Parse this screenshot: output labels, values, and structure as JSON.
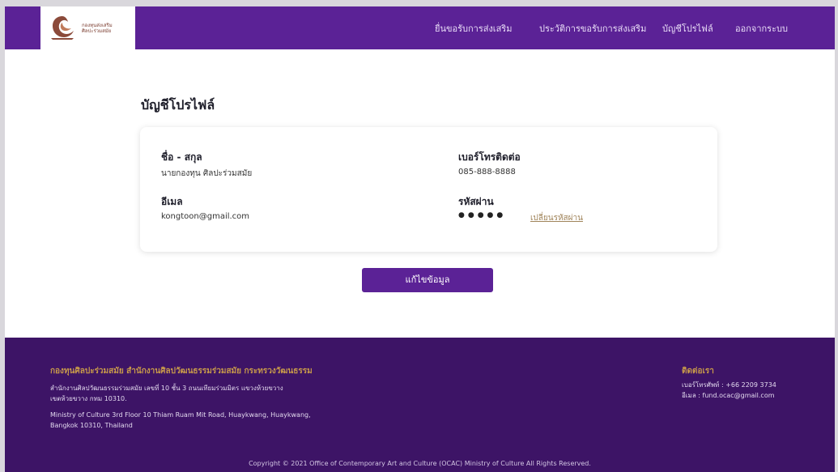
{
  "header": {
    "logo": {
      "line1": "กองทุนส่งเสริม",
      "line2": "ศิลปะร่วมสมัย"
    },
    "nav": [
      {
        "label": "ยื่นขอรับการส่งเสริม"
      },
      {
        "label": "ประวัติการขอรับการส่งเสริม"
      },
      {
        "label": "บัญชีโปรไฟล์"
      },
      {
        "label": "ออกจากระบบ"
      }
    ]
  },
  "main": {
    "title": "บัญชีโปรไฟล์",
    "profile": {
      "name_label": "ชื่อ - สกุล",
      "name_value": "นายกองทุน ศิลปะร่วมสมัย",
      "phone_label": "เบอร์โทรติดต่อ",
      "phone_value": "085-888-8888",
      "email_label": "อีเมล",
      "email_value": "kongtoon@gmail.com",
      "password_label": "รหัสผ่าน",
      "password_mask": "●●●●●",
      "change_password": "เปลี่ยนรหัสผ่าน"
    },
    "edit_button": "แก้ไขข้อมูล"
  },
  "footer": {
    "org_title": "กองทุนศิลปะร่วมสมัย สำนักงานศิลปวัฒนธรรมร่วมสมัย กระทรวงวัฒนธรรม",
    "address_th_1": "สำนักงานศิลปวัฒนธรรมร่วมสมัย เลขที่ 10 ชั้น 3 ถนนเทียมร่วมมิตร แขวงห้วยขวาง",
    "address_th_2": "เขตห้วยขวาง กทม 10310.",
    "address_en_1": "Ministry of Culture 3rd Floor 10 Thiam Ruam Mit Road, Huaykwang, Huaykwang,",
    "address_en_2": "Bangkok 10310, Thailand",
    "contact_title": "ติดต่อเรา",
    "contact_phone": "เบอร์โทรศัพท์ : +66 2209 3734",
    "contact_email": "อีเมล : fund.ocac@gmail.com",
    "copyright": "Copyright © 2021 Office of Contemporary Art and Culture (OCAC) Ministry of Culture All Rights Reserved."
  },
  "colors": {
    "primary": "#5b2296",
    "footer_bg": "#3d1466",
    "accent_gold": "#c89a4a"
  }
}
